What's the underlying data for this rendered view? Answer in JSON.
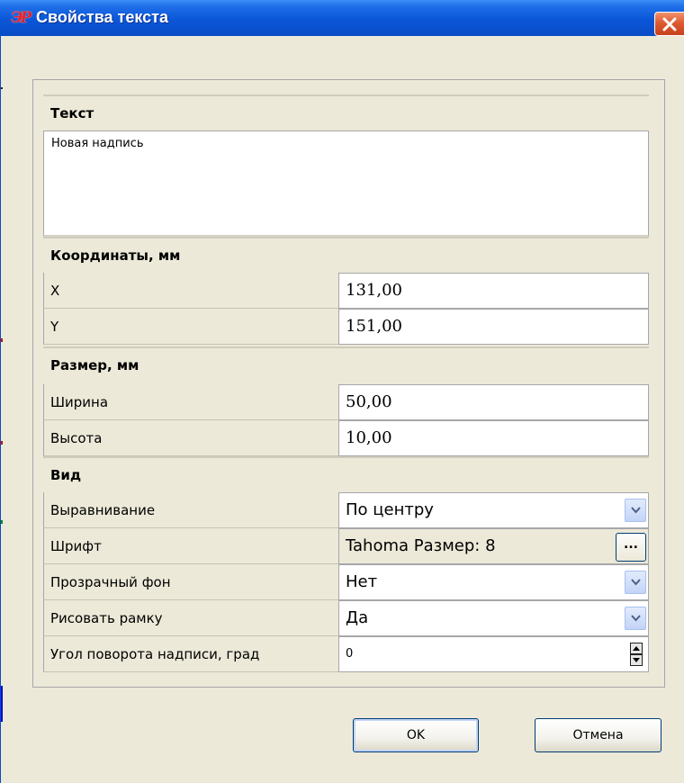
{
  "window": {
    "title": "Свойства текста",
    "app_icon_text": "ЭР"
  },
  "sections": {
    "text": "Текст",
    "coordinates": "Координаты, мм",
    "size": "Размер, мм",
    "view": "Вид"
  },
  "text_value": "Новая надпись",
  "coordinates": {
    "x_label": "X",
    "x_value": "131,00",
    "y_label": "Y",
    "y_value": "151,00"
  },
  "size": {
    "width_label": "Ширина",
    "width_value": "50,00",
    "height_label": "Высота",
    "height_value": "10,00"
  },
  "view": {
    "align_label": "Выравнивание",
    "align_value": "По центру",
    "font_label": "Шрифт",
    "font_value": "Tahoma Размер: 8",
    "font_button": "...",
    "transparent_label": "Прозрачный фон",
    "transparent_value": "Нет",
    "border_label": "Рисовать рамку",
    "border_value": "Да",
    "angle_label": "Угол поворота надписи, град",
    "angle_value": "0"
  },
  "buttons": {
    "ok": "OK",
    "cancel": "Отмена"
  },
  "icons": {
    "close": "close-icon",
    "dropdown": "chevron-down-icon",
    "spin": "spin-updown-icon"
  }
}
